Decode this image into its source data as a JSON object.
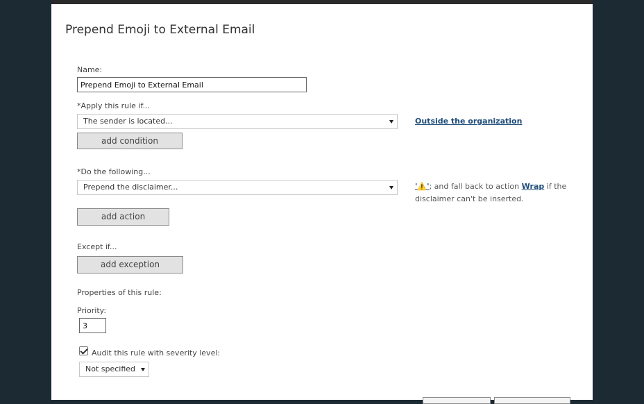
{
  "dialog": {
    "title": "Prepend Emoji to External Email"
  },
  "name": {
    "label": "Name:",
    "value": "Prepend Emoji to External Email"
  },
  "condition": {
    "label": "*Apply this rule if...",
    "selected": "The sender is located...",
    "value_link": "Outside the organization",
    "add_button": "add condition"
  },
  "action": {
    "label": "*Do the following...",
    "selected": "Prepend the disclaimer...",
    "emoji_link": "'⚠️'",
    "desc_part1": "; and fall back to action ",
    "fallback_link": "Wrap",
    "desc_part2": " if the disclaimer can't be inserted.",
    "add_button": "add action"
  },
  "exception": {
    "label": "Except if...",
    "add_button": "add exception"
  },
  "properties": {
    "label": "Properties of this rule:",
    "priority_label": "Priority:",
    "priority_value": "3",
    "audit_label": "Audit this rule with severity level:",
    "audit_checked": true,
    "severity_selected": "Not specified"
  }
}
